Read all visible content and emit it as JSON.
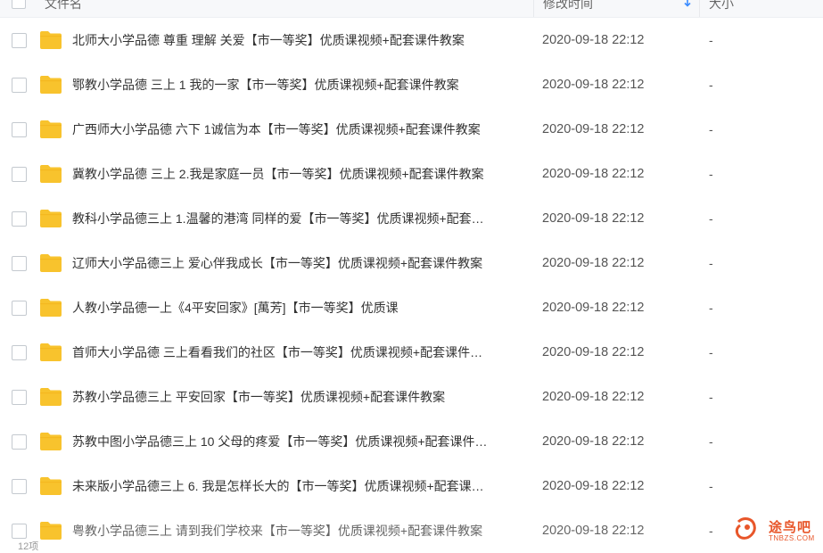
{
  "header": {
    "name_label": "文件名",
    "time_label": "修改时间",
    "size_label": "大小"
  },
  "files": [
    {
      "name": "北师大小学品德 尊重 理解 关爱【市一等奖】优质课视频+配套课件教案",
      "time": "2020-09-18 22:12",
      "size": "-"
    },
    {
      "name": "鄂教小学品德 三上 1 我的一家【市一等奖】优质课视频+配套课件教案",
      "time": "2020-09-18 22:12",
      "size": "-"
    },
    {
      "name": "广西师大小学品德 六下 1诚信为本【市一等奖】优质课视频+配套课件教案",
      "time": "2020-09-18 22:12",
      "size": "-"
    },
    {
      "name": "冀教小学品德 三上 2.我是家庭一员【市一等奖】优质课视频+配套课件教案",
      "time": "2020-09-18 22:12",
      "size": "-"
    },
    {
      "name": "教科小学品德三上 1.温馨的港湾 同样的爱【市一等奖】优质课视频+配套…",
      "time": "2020-09-18 22:12",
      "size": "-"
    },
    {
      "name": "辽师大小学品德三上 爱心伴我成长【市一等奖】优质课视频+配套课件教案",
      "time": "2020-09-18 22:12",
      "size": "-"
    },
    {
      "name": "人教小学品德一上《4平安回家》[萬芳]【市一等奖】优质课",
      "time": "2020-09-18 22:12",
      "size": "-"
    },
    {
      "name": "首师大小学品德 三上看看我们的社区【市一等奖】优质课视频+配套课件…",
      "time": "2020-09-18 22:12",
      "size": "-"
    },
    {
      "name": "苏教小学品德三上 平安回家【市一等奖】优质课视频+配套课件教案",
      "time": "2020-09-18 22:12",
      "size": "-"
    },
    {
      "name": "苏教中图小学品德三上 10 父母的疼爱【市一等奖】优质课视频+配套课件…",
      "time": "2020-09-18 22:12",
      "size": "-"
    },
    {
      "name": "未来版小学品德三上 6. 我是怎样长大的【市一等奖】优质课视频+配套课…",
      "time": "2020-09-18 22:12",
      "size": "-"
    },
    {
      "name": "粤教小学品德三上 请到我们学校来【市一等奖】优质课视频+配套课件教案",
      "time": "2020-09-18 22:12",
      "size": "-"
    }
  ],
  "footer": {
    "count_text": "12项"
  },
  "watermark": {
    "text": "途鸟吧",
    "sub": "TNBZS.COM"
  },
  "colors": {
    "folder": "#f8c32d",
    "watermark": "#e8562a"
  }
}
